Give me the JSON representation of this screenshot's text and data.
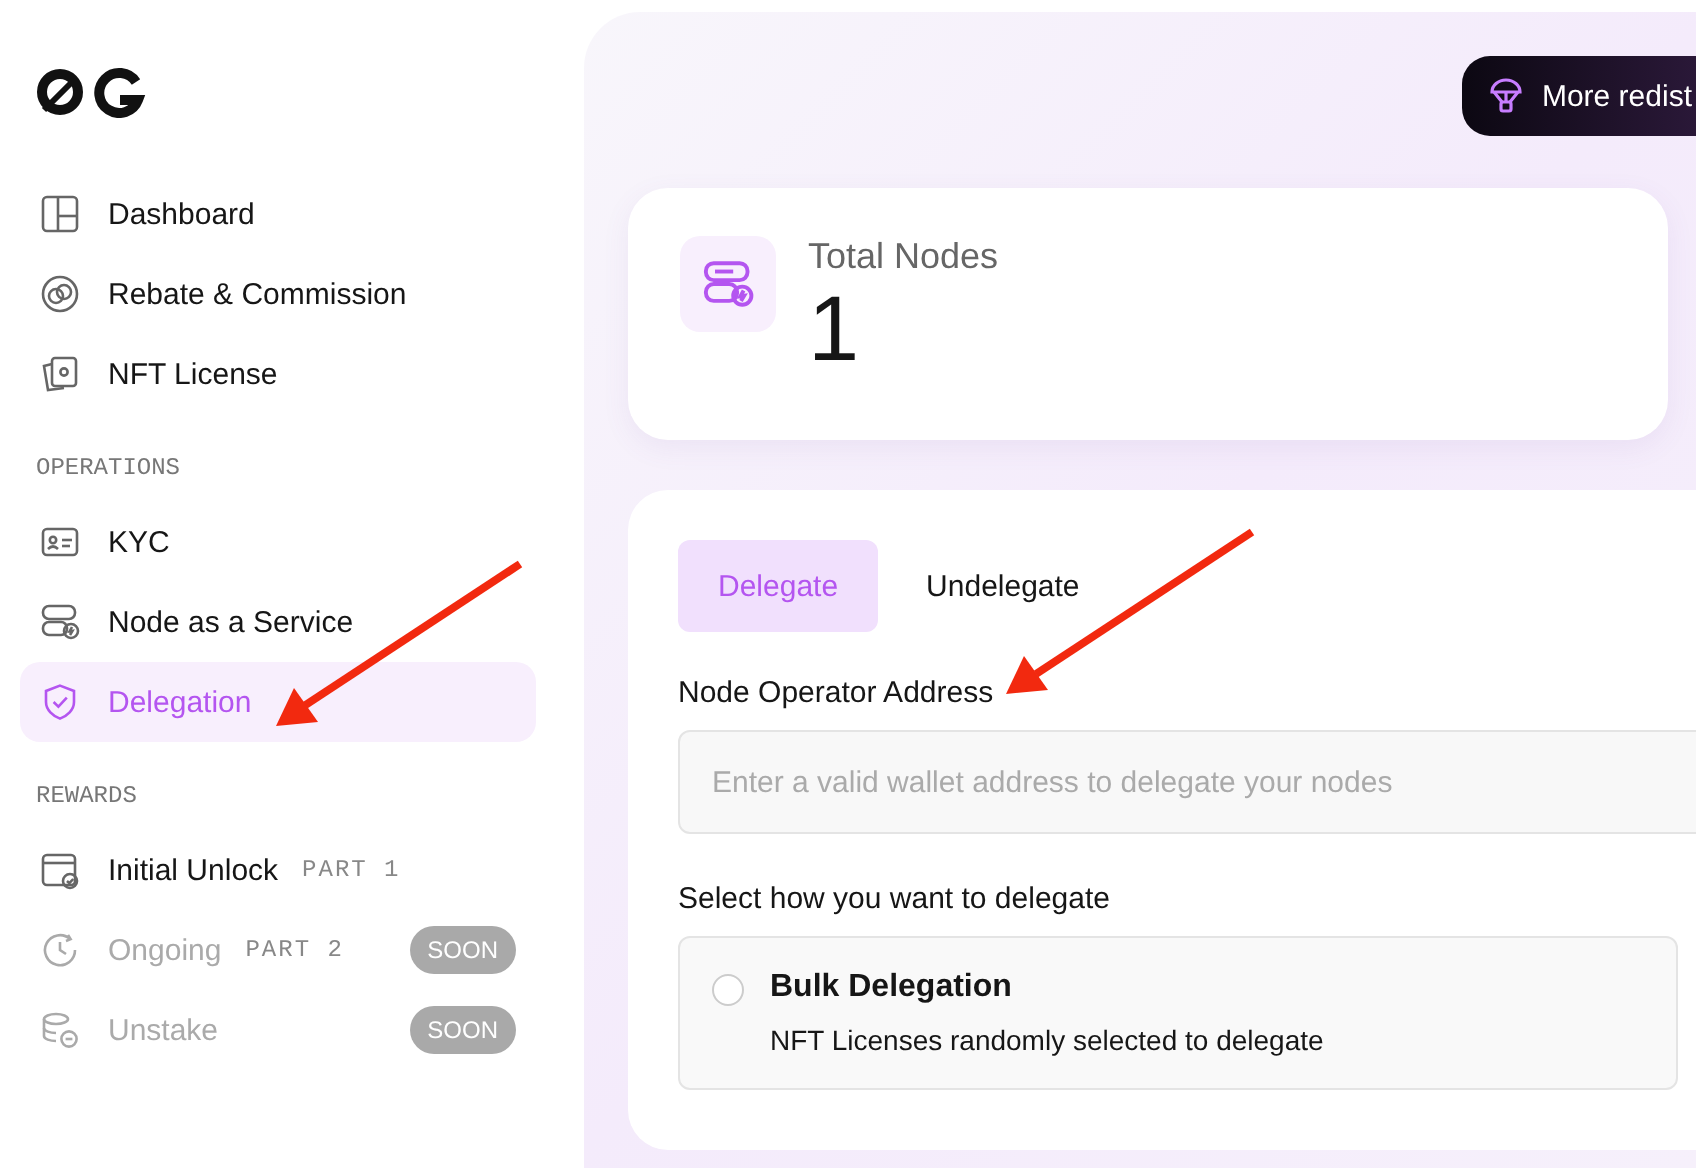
{
  "sidebar": {
    "sections": [
      {
        "items": [
          {
            "label": "Dashboard",
            "selected": false,
            "disabled": false
          },
          {
            "label": "Rebate & Commission",
            "selected": false,
            "disabled": false
          },
          {
            "label": "NFT License",
            "selected": false,
            "disabled": false
          }
        ]
      },
      {
        "title": "OPERATIONS",
        "items": [
          {
            "label": "KYC",
            "selected": false,
            "disabled": false
          },
          {
            "label": "Node as a Service",
            "selected": false,
            "disabled": false
          },
          {
            "label": "Delegation",
            "selected": true,
            "disabled": false
          }
        ]
      },
      {
        "title": "REWARDS",
        "items": [
          {
            "label": "Initial Unlock",
            "tag": "PART 1",
            "selected": false,
            "disabled": false
          },
          {
            "label": "Ongoing",
            "tag": "PART 2",
            "badge": "SOON",
            "selected": false,
            "disabled": true
          },
          {
            "label": "Unstake",
            "badge": "SOON",
            "selected": false,
            "disabled": true
          }
        ]
      }
    ]
  },
  "header": {
    "button": "More redist"
  },
  "stat_card": {
    "label": "Total Nodes",
    "value": "1"
  },
  "form": {
    "tabs": [
      {
        "label": "Delegate",
        "selected": true
      },
      {
        "label": "Undelegate",
        "selected": false
      }
    ],
    "field": {
      "label": "Node Operator Address",
      "placeholder": "Enter a valid wallet address to delegate your nodes"
    },
    "question": "Select how you want to delegate",
    "options": [
      {
        "title": "Bulk Delegation",
        "description": "NFT Licenses randomly selected to delegate",
        "selected": false
      }
    ]
  }
}
